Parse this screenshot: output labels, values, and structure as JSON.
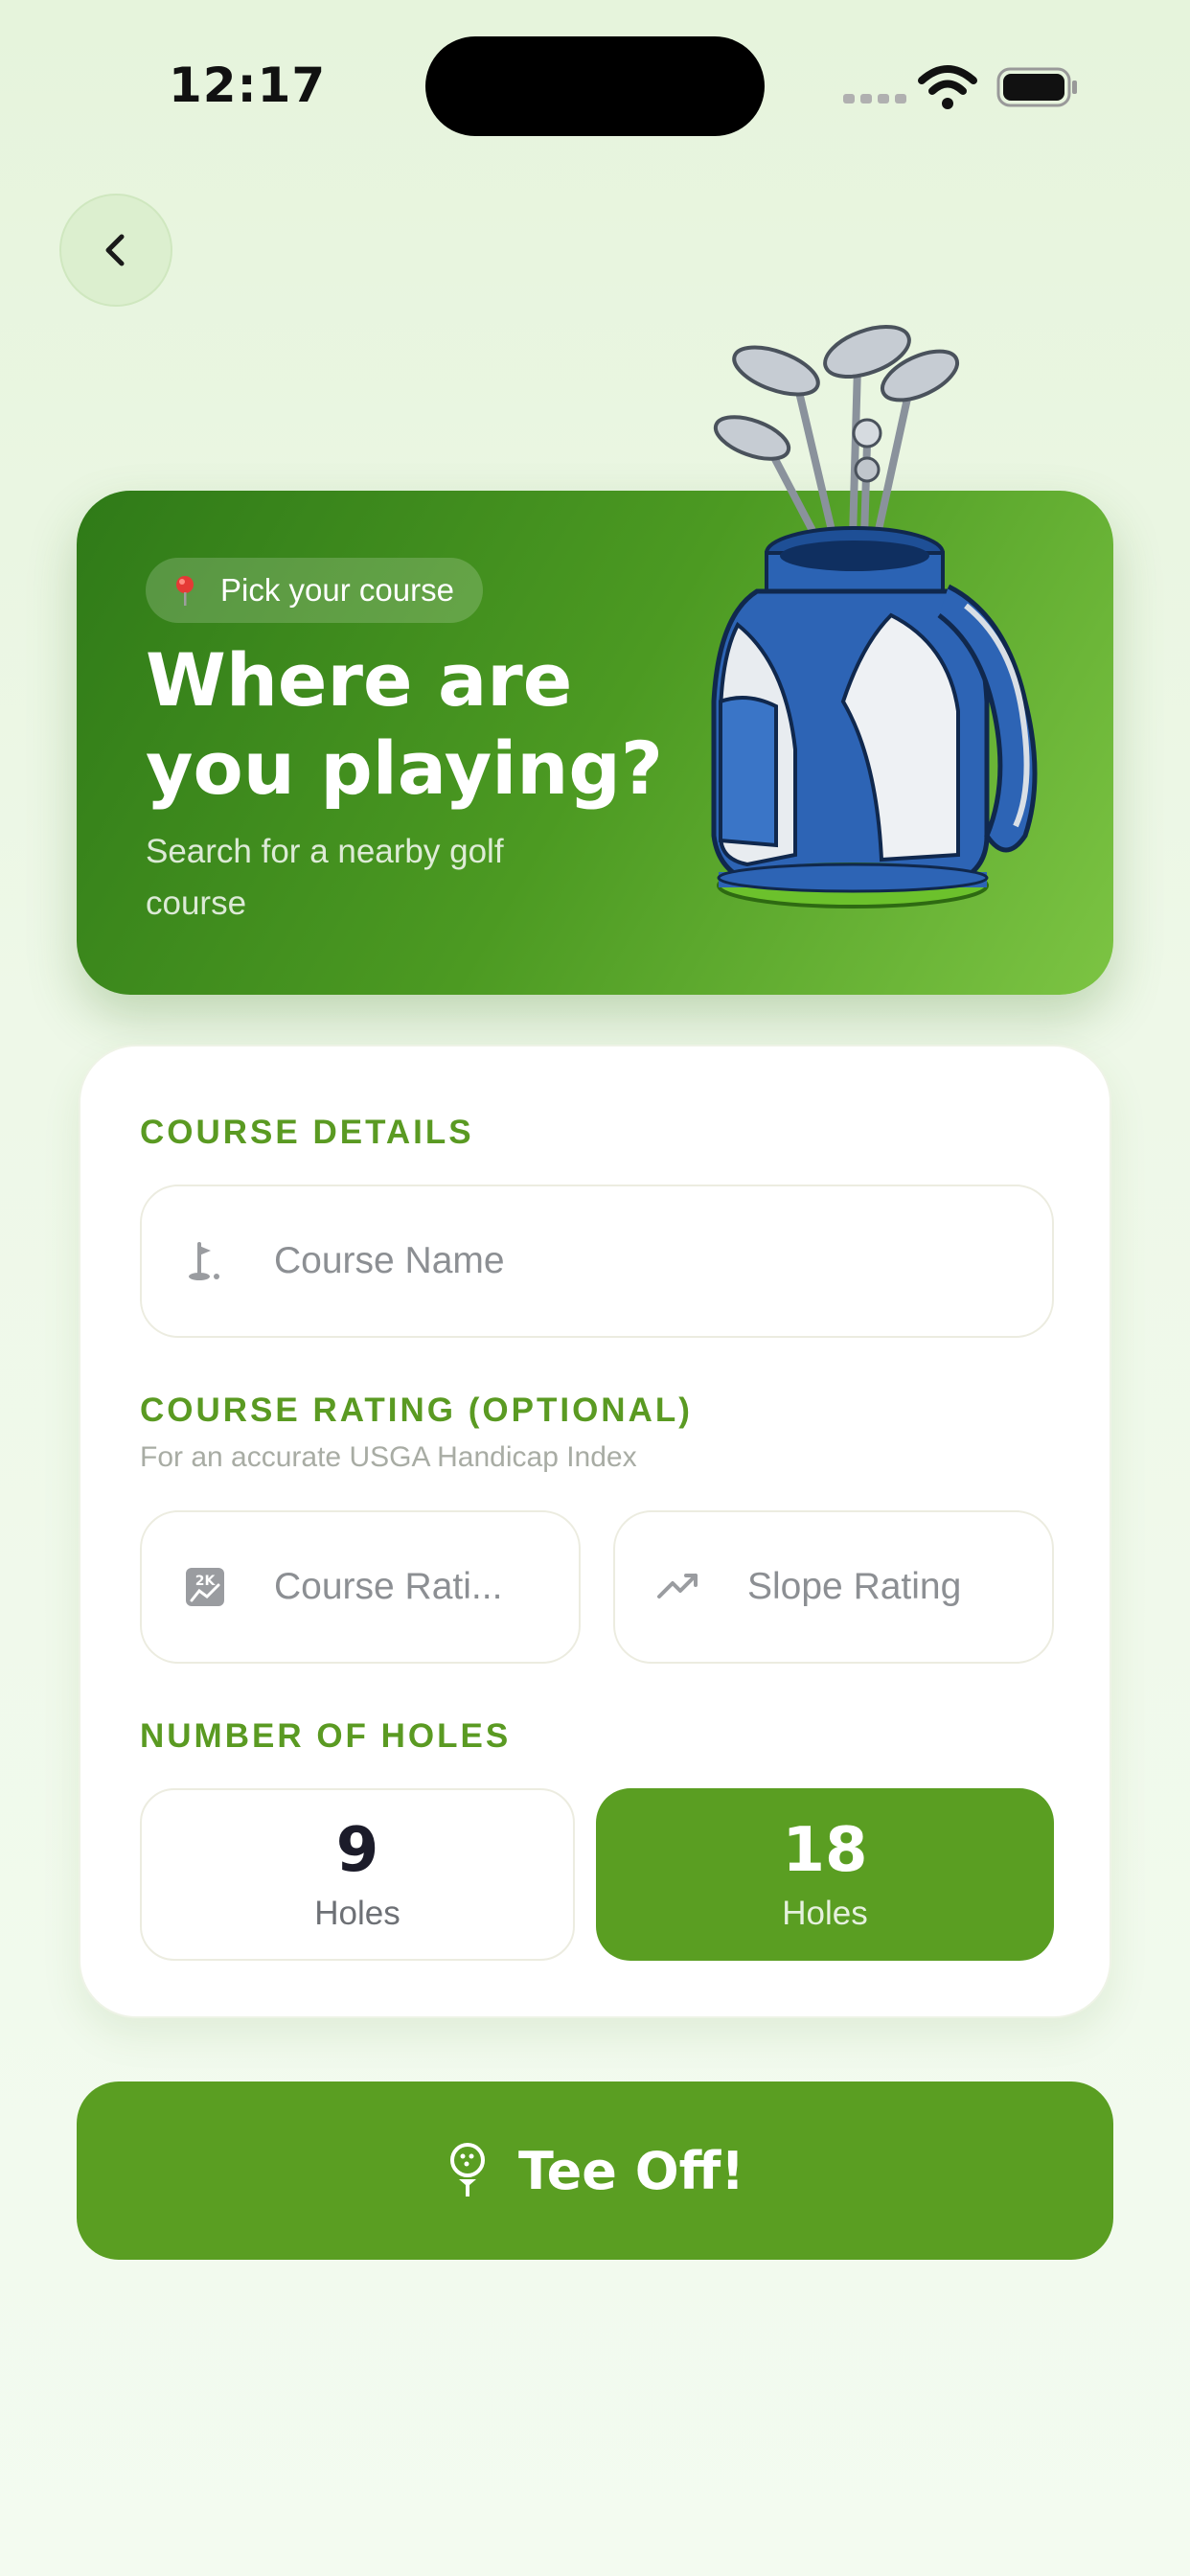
{
  "status_bar": {
    "time": "12:17"
  },
  "hero": {
    "pill_label": "Pick your course",
    "title": "Where are you playing?",
    "subtitle": "Search for a nearby golf course"
  },
  "course_details": {
    "label": "COURSE DETAILS",
    "course_name_placeholder": "Course Name"
  },
  "course_rating": {
    "label": "COURSE RATING (OPTIONAL)",
    "hint": "For an accurate USGA Handicap Index",
    "course_rating_placeholder": "Course Rati...",
    "slope_rating_placeholder": "Slope Rating"
  },
  "holes": {
    "label": "NUMBER OF HOLES",
    "options": [
      {
        "number": "9",
        "label": "Holes",
        "selected": false
      },
      {
        "number": "18",
        "label": "Holes",
        "selected": true
      }
    ]
  },
  "cta": {
    "label": "Tee Off!"
  },
  "colors": {
    "accent_green": "#5a9e22",
    "hero_dark": "#2f7a18",
    "hero_light": "#7cc443",
    "section_label": "#5a9a22"
  },
  "icons": {
    "back": "chevron-left-icon",
    "pin": "map-pin-icon",
    "course_name": "golf-flag-icon",
    "course_rating": "rating-chart-icon",
    "slope_rating": "trending-up-icon",
    "cta": "golf-ball-tee-icon"
  }
}
